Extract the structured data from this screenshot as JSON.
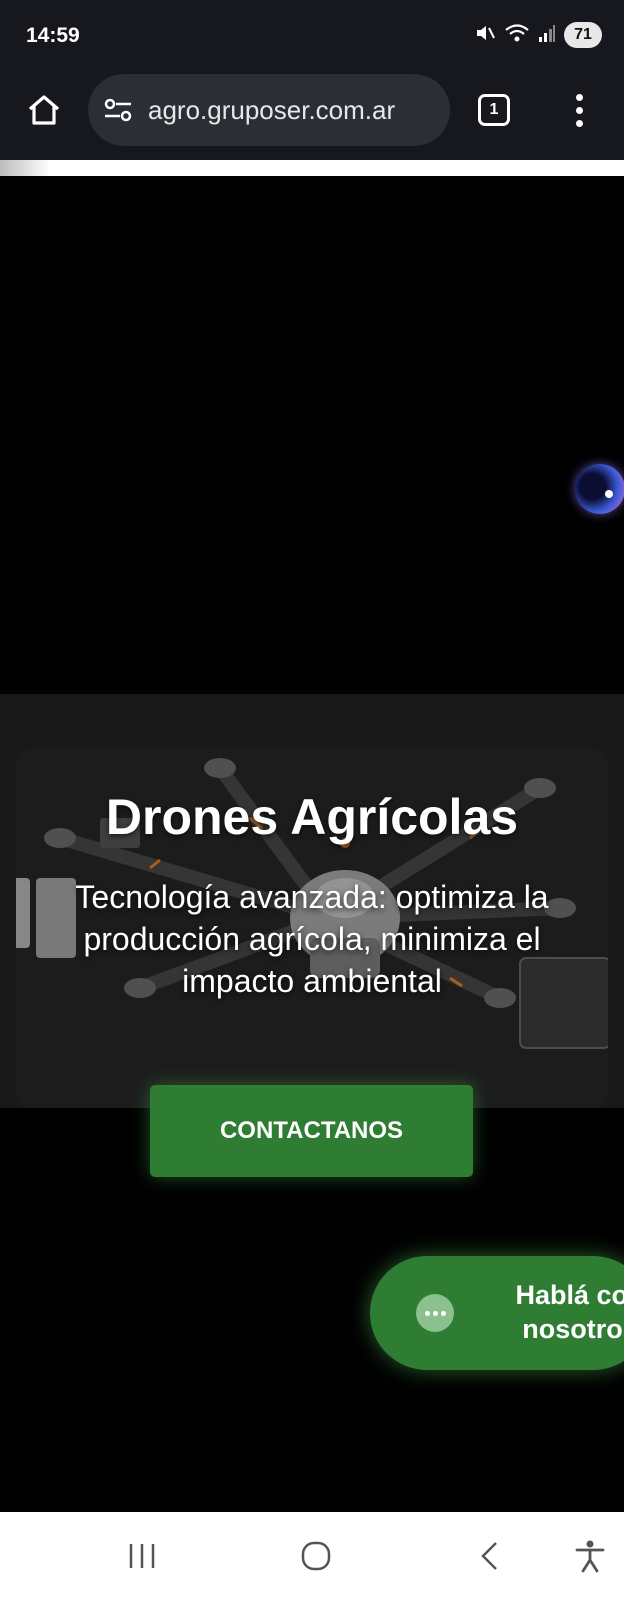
{
  "status_bar": {
    "time": "14:59",
    "battery": "71",
    "icons": [
      "mute-icon",
      "wifi-icon",
      "signal-icon"
    ]
  },
  "browser": {
    "url": "agro.gruposer.com.ar",
    "tab_count": "1",
    "icons": [
      "home-icon",
      "site-info-icon",
      "tabs-icon",
      "more-icon"
    ],
    "load_progress": 0.08
  },
  "hero": {
    "title": "Drones Agrícolas",
    "subtitle": "Tecnología avanzada: optimiza la producción agrícola, minimiza el impacto ambiental",
    "cta_label": "CONTACTANOS"
  },
  "chat_widget": {
    "label": "Hablá con nosotros"
  },
  "colors": {
    "accent_green": "#2e7d32",
    "browser_chrome": "#16181d",
    "page_background": "#000000"
  },
  "nav_bar": {
    "icons": [
      "recents-icon",
      "home-circle-icon",
      "back-icon",
      "accessibility-icon"
    ]
  }
}
